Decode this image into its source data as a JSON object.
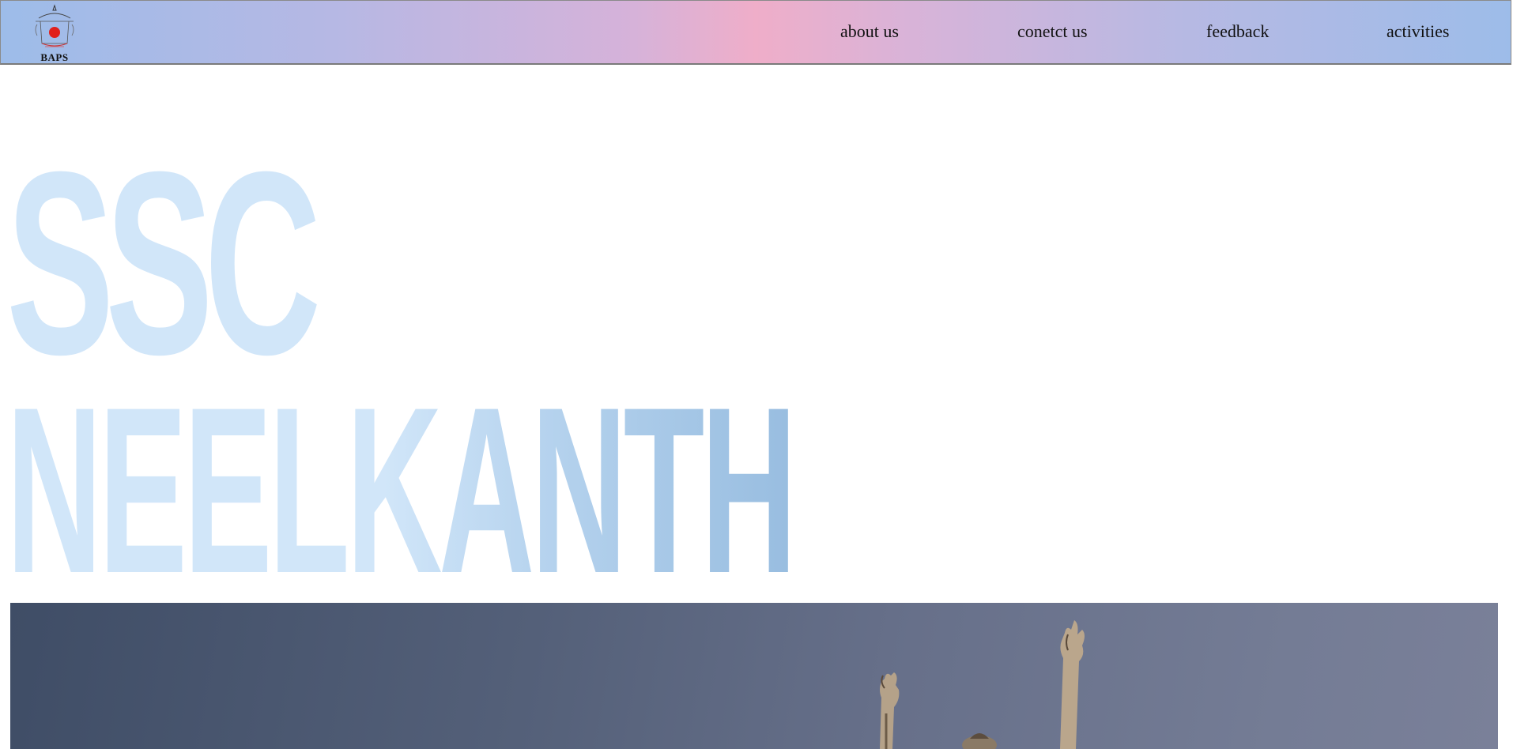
{
  "header": {
    "logo": {
      "text": "BAPS",
      "icon": "baps-temple-logo-icon"
    },
    "nav": [
      {
        "label": "about us"
      },
      {
        "label": "conetct us"
      },
      {
        "label": "feedback"
      },
      {
        "label": "activities"
      }
    ]
  },
  "hero": {
    "line1": "SSC",
    "line2": "NEELKANTH",
    "image": {
      "icon": "raised-hands-statue-image"
    }
  },
  "colors": {
    "hero_text": "#d1e6f9",
    "hero_text_gradient_end": "#98bde0",
    "header_gradient_start": "#9dbce9",
    "header_gradient_center": "#efaec9"
  }
}
